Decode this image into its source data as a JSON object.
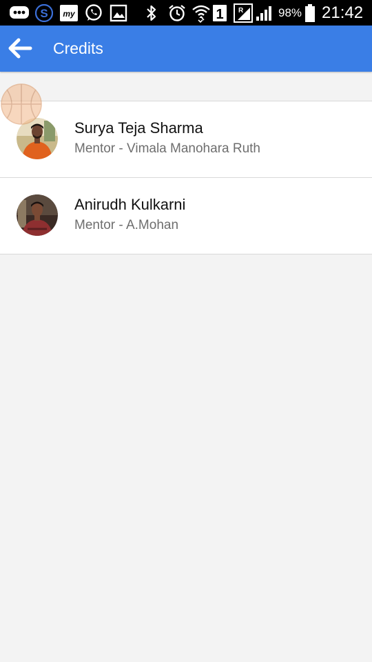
{
  "status_bar": {
    "battery_percent": "98%",
    "time": "21:42",
    "sim_badge": "1",
    "icons": [
      "messenger-icon",
      "skype-icon",
      "mytelcel-icon",
      "whatsapp-icon",
      "gallery-icon",
      "bluetooth-icon",
      "alarm-icon",
      "wifi-icon",
      "sim-icon",
      "signal-roaming-icon",
      "signal-icon",
      "battery-icon"
    ]
  },
  "app_bar": {
    "back_icon": "arrow-left-icon",
    "title": "Credits",
    "color": "#3a7ee6"
  },
  "credits": [
    {
      "name": "Surya Teja Sharma",
      "subtitle": "Mentor - Vimala Manohara Ruth",
      "avatar": "avatar-photo"
    },
    {
      "name": "Anirudh Kulkarni",
      "subtitle": "Mentor - A.Mohan",
      "avatar": "avatar-photo"
    }
  ]
}
